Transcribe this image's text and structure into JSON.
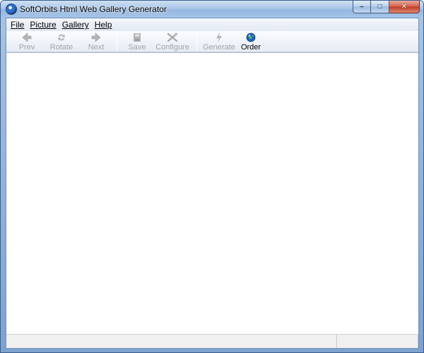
{
  "window": {
    "title": "SoftOrbits Html Web Gallery Generator",
    "icon": "app-globe-icon",
    "caption_buttons": {
      "minimize": "–",
      "maximize": "□",
      "close": "✕"
    }
  },
  "menubar": {
    "items": [
      {
        "name": "menu-file",
        "label": "File"
      },
      {
        "name": "menu-picture",
        "label": "Picture"
      },
      {
        "name": "menu-gallery",
        "label": "Gallery"
      },
      {
        "name": "menu-help",
        "label": "Help"
      }
    ]
  },
  "toolbar": {
    "prev": {
      "label": "Prev",
      "icon": "arrow-left-icon",
      "enabled": false
    },
    "rotate": {
      "label": "Rotate",
      "icon": "rotate-icon",
      "enabled": false
    },
    "next": {
      "label": "Next",
      "icon": "arrow-right-icon",
      "enabled": false
    },
    "save": {
      "label": "Save",
      "icon": "save-icon",
      "enabled": false
    },
    "configure": {
      "label": "Configure",
      "icon": "tools-icon",
      "enabled": false
    },
    "generate": {
      "label": "Generate",
      "icon": "lightning-icon",
      "enabled": false
    },
    "order": {
      "label": "Order",
      "icon": "globe-icon",
      "enabled": true
    }
  },
  "colors": {
    "disabled_text": "#a3a3a3",
    "title_bar": "#a9c6e8",
    "close_button": "#c03a22"
  }
}
